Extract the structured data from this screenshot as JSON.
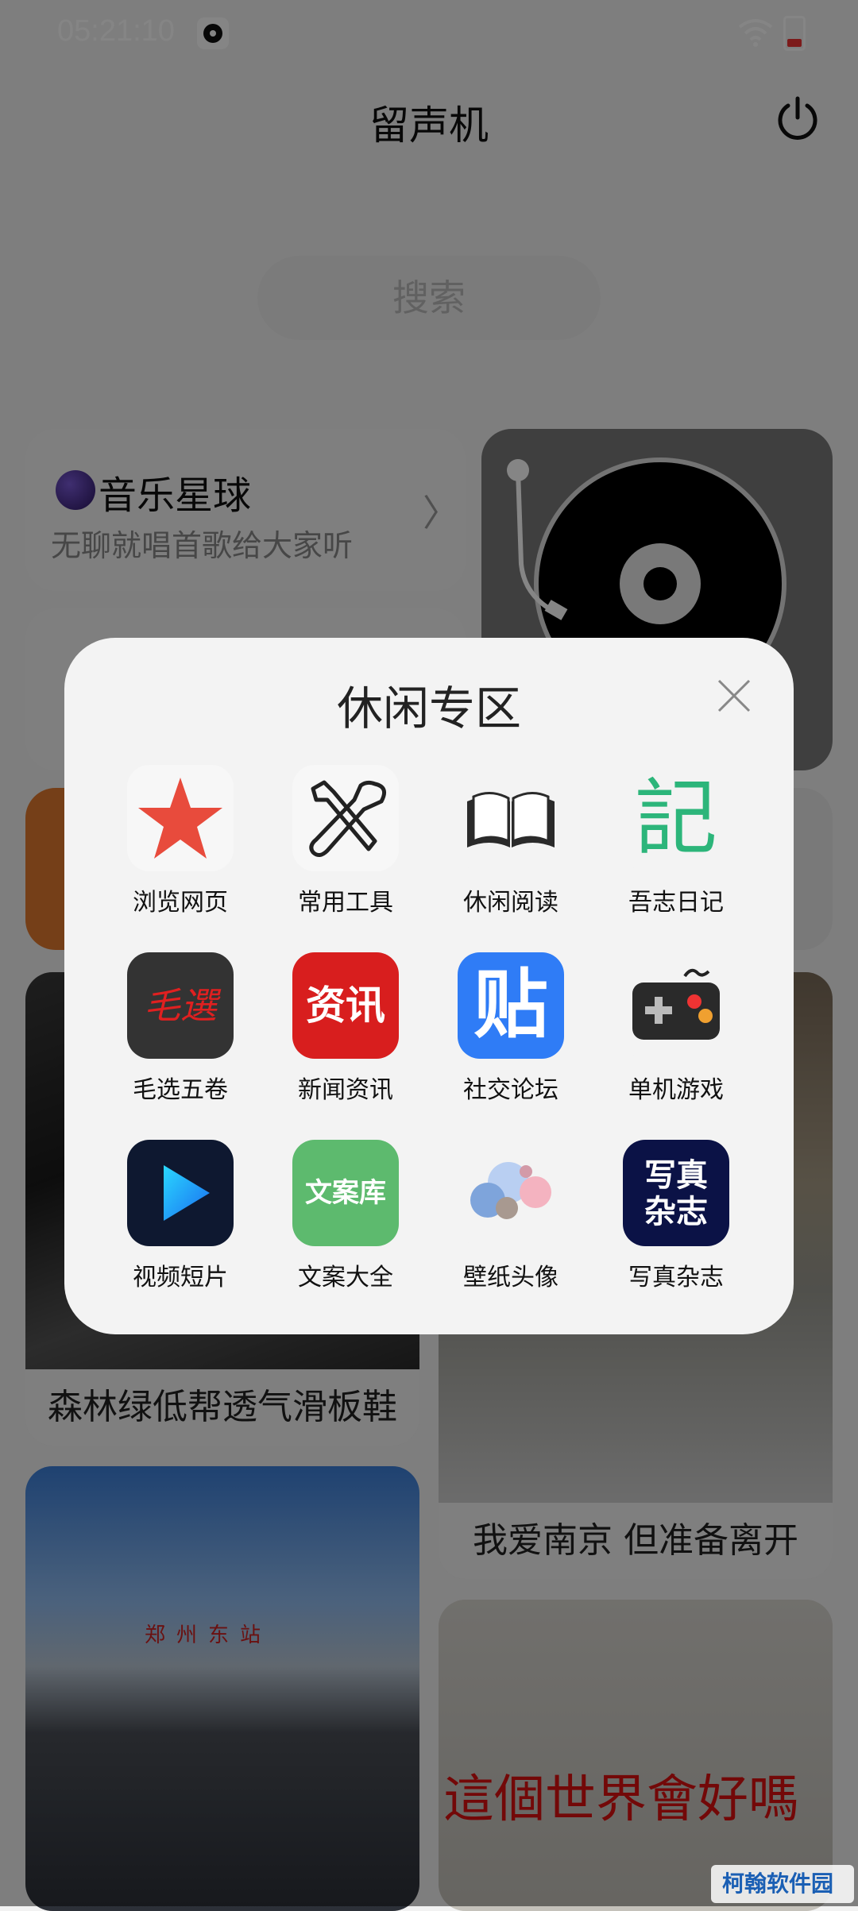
{
  "status_bar": {
    "time": "05:21:10"
  },
  "header": {
    "title": "留声机"
  },
  "search": {
    "label": "搜索"
  },
  "music_card": {
    "title": "音乐星球",
    "subtitle": "无聊就唱首歌给大家听"
  },
  "feed": {
    "left_caption_1": "森林绿低帮透气滑板鞋",
    "right_caption_1": "我爱南京 但准备离开",
    "station_sign": "郑州东站",
    "wall_text": "這個世界會好嗎"
  },
  "modal": {
    "title": "休闲专区",
    "tiles": [
      {
        "label": "浏览网页",
        "icon": "star-icon"
      },
      {
        "label": "常用工具",
        "icon": "tools-icon"
      },
      {
        "label": "休闲阅读",
        "icon": "book-icon"
      },
      {
        "label": "吾志日记",
        "icon": "diary-icon",
        "glyph": "記"
      },
      {
        "label": "毛选五卷",
        "icon": "mao-selection-icon",
        "glyph": "毛選"
      },
      {
        "label": "新闻资讯",
        "icon": "news-icon",
        "glyph": "资讯"
      },
      {
        "label": "社交论坛",
        "icon": "forum-icon",
        "glyph": "贴"
      },
      {
        "label": "单机游戏",
        "icon": "gamepad-icon"
      },
      {
        "label": "视频短片",
        "icon": "play-icon"
      },
      {
        "label": "文案大全",
        "icon": "copywriting-icon",
        "glyph": "文案库"
      },
      {
        "label": "壁纸头像",
        "icon": "wallpaper-icon"
      },
      {
        "label": "写真杂志",
        "icon": "magazine-icon",
        "glyph": "写真杂志"
      }
    ]
  },
  "watermark": {
    "text": "柯翰软件园"
  },
  "colors": {
    "star": "#e84b3c",
    "news_red": "#d81e1e",
    "forum_blue": "#2f7cf6",
    "copy_green": "#5dba6e",
    "magazine_navy": "#0b1246",
    "diary_green": "#2cb57a"
  }
}
